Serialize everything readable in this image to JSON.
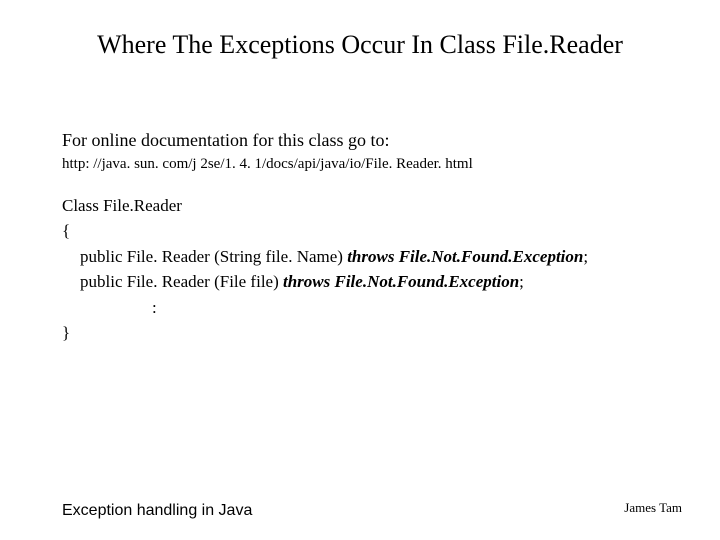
{
  "title": "Where The Exceptions Occur In Class File.Reader",
  "intro": "For online documentation for this class go to:",
  "url": "http: //java. sun. com/j 2se/1. 4. 1/docs/api/java/io/File. Reader. html",
  "cls": {
    "heading": "Class File.Reader",
    "open": "{",
    "line1_pre": "public File. Reader (String file. Name) ",
    "line1_throws": "throws File.Not.Found.Exception",
    "line1_post": ";",
    "line2_pre": "public File. Reader (File file) ",
    "line2_throws": "throws File.Not.Found.Exception",
    "line2_post": ";",
    "colon": ":",
    "close": "}"
  },
  "footer": {
    "left": "Exception handling in Java",
    "right": "James Tam"
  }
}
